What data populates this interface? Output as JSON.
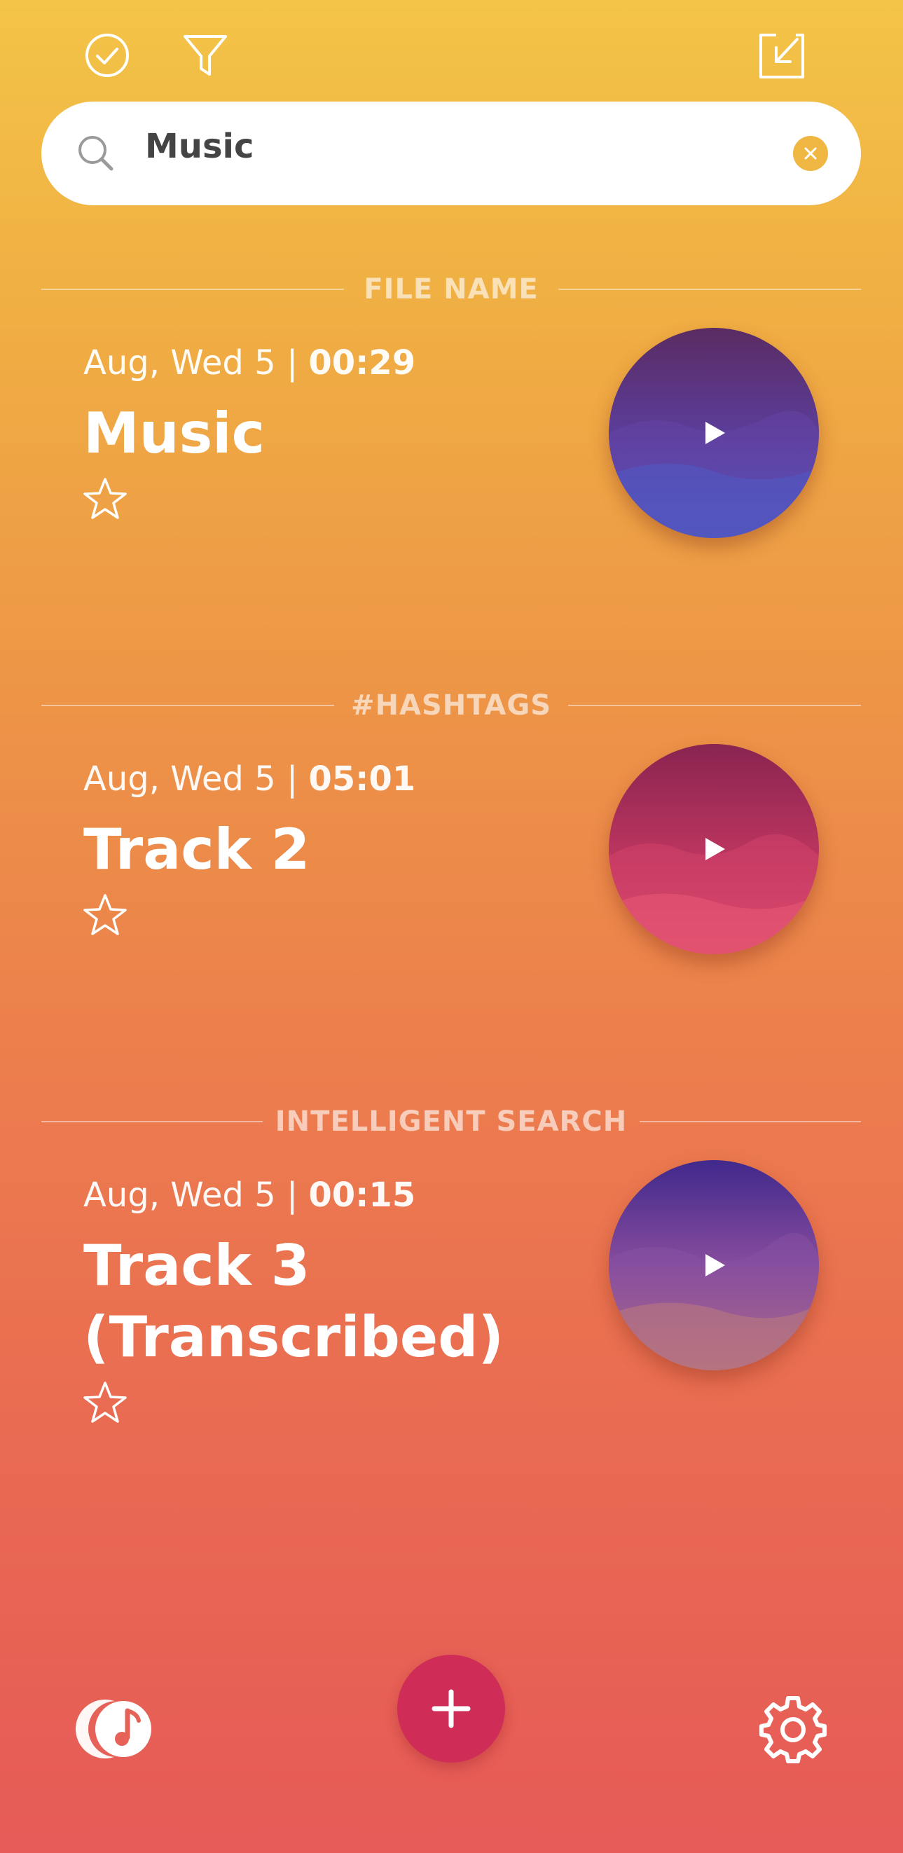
{
  "toolbar": {
    "select_icon": "check-circle-icon",
    "filter_icon": "filter-icon",
    "import_icon": "import-icon"
  },
  "search": {
    "value": "Music",
    "clear_icon": "clear-icon",
    "accent_color": "#efb642"
  },
  "sections": [
    {
      "header": "FILE NAME",
      "item": {
        "date": "Aug, Wed 5 | ",
        "duration": "00:29",
        "title": "Music",
        "disc_colors": [
          "#5a2e6a",
          "#5a3fa8",
          "#4a5bc3"
        ]
      }
    },
    {
      "header": "#HASHTAGS",
      "item": {
        "date": "Aug, Wed 5 | ",
        "duration": "05:01",
        "title": "Track 2",
        "disc_colors": [
          "#8a2452",
          "#c43a62",
          "#e2516e"
        ]
      }
    },
    {
      "header": "INTELLIGENT SEARCH",
      "item": {
        "date": "Aug, Wed 5 | ",
        "duration": "00:15",
        "title_line1": "Track 3",
        "title_line2": "(Transcribed)",
        "disc_colors": [
          "#432c8e",
          "#8a4c9c",
          "#c07a6e"
        ]
      }
    }
  ],
  "bottom_bar": {
    "logo_icon": "music-moon-logo-icon",
    "add_icon": "plus-icon",
    "settings_icon": "gear-icon",
    "fab_color": "#cf2d58"
  }
}
